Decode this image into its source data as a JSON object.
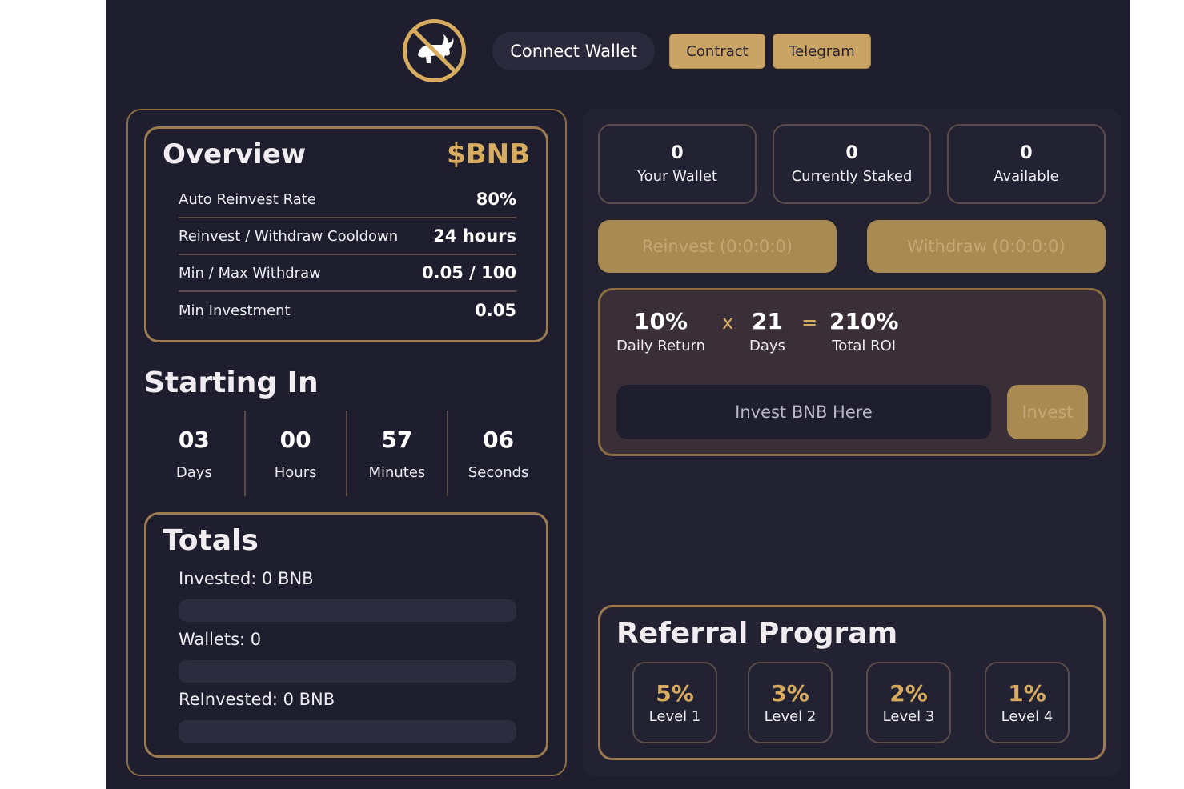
{
  "header": {
    "logo_icon": "no-bull-icon",
    "connect_wallet": "Connect Wallet",
    "contract": "Contract",
    "telegram": "Telegram"
  },
  "overview": {
    "title": "Overview",
    "token": "$BNB",
    "rows": [
      {
        "label": "Auto Reinvest Rate",
        "value": "80%"
      },
      {
        "label": "Reinvest / Withdraw Cooldown",
        "value": "24 hours"
      },
      {
        "label": "Min / Max Withdraw",
        "value": "0.05 / 100"
      },
      {
        "label": "Min Investment",
        "value": "0.05"
      }
    ]
  },
  "starting": {
    "title": "Starting In",
    "cells": [
      {
        "value": "03",
        "label": "Days"
      },
      {
        "value": "00",
        "label": "Hours"
      },
      {
        "value": "57",
        "label": "Minutes"
      },
      {
        "value": "06",
        "label": "Seconds"
      }
    ]
  },
  "totals": {
    "title": "Totals",
    "invested": "Invested: 0 BNB",
    "wallets": "Wallets: 0",
    "reinvested": "ReInvested: 0 BNB"
  },
  "stats": [
    {
      "value": "0",
      "label": "Your Wallet"
    },
    {
      "value": "0",
      "label": "Currently Staked"
    },
    {
      "value": "0",
      "label": "Available"
    }
  ],
  "actions": {
    "reinvest": "Reinvest (0:0:0:0)",
    "withdraw": "Withdraw (0:0:0:0)"
  },
  "invest": {
    "daily_value": "10%",
    "daily_label": "Daily Return",
    "times": "x",
    "days_value": "21",
    "days_label": "Days",
    "equals": "=",
    "roi_value": "210%",
    "roi_label": "Total ROI",
    "placeholder": "Invest BNB Here",
    "button": "Invest"
  },
  "referral": {
    "title": "Referral Program",
    "levels": [
      {
        "pct": "5%",
        "label": "Level 1"
      },
      {
        "pct": "3%",
        "label": "Level 2"
      },
      {
        "pct": "2%",
        "label": "Level 3"
      },
      {
        "pct": "1%",
        "label": "Level 4"
      }
    ]
  },
  "colors": {
    "background": "#1f1e2f",
    "gold": "#d8ac5f",
    "button_gold": "#c9a464",
    "border": "#9c7b51"
  }
}
